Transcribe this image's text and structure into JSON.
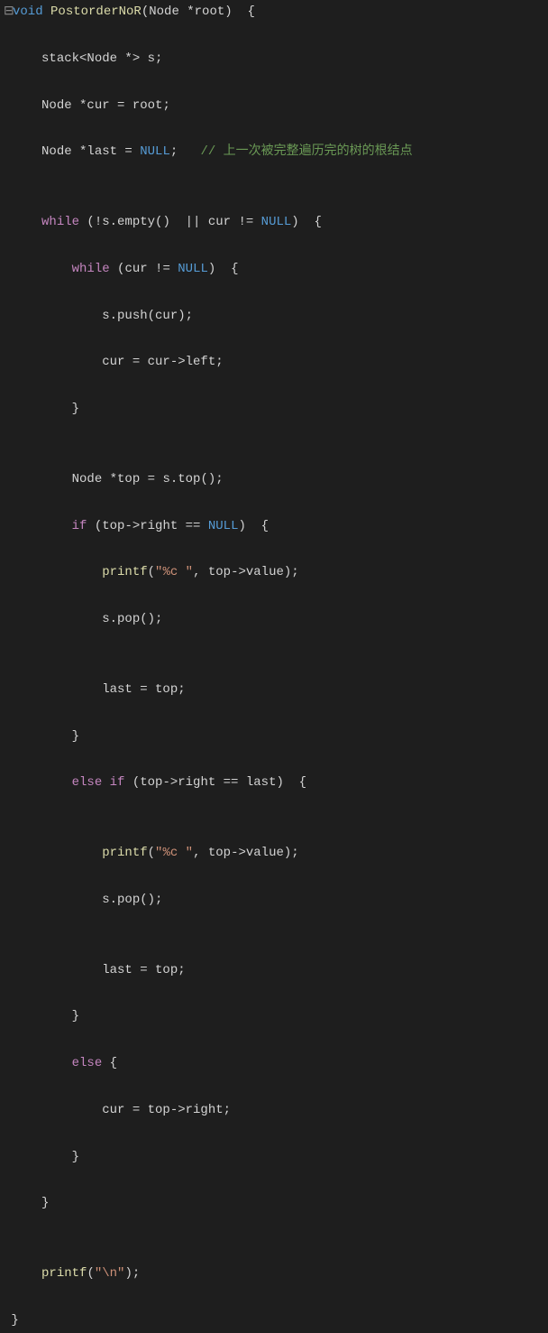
{
  "code": {
    "l01_collapse": "⊟",
    "l01_kw": "void",
    "l01_func": "PostorderNoR",
    "l01_params": "(Node *root)  {",
    "l02": "stack<Node *> s;",
    "l03": "Node *cur = root;",
    "l04_a": "Node *last = ",
    "l04_null": "NULL",
    "l04_b": ";   ",
    "l04_comment": "// 上一次被完整遍历完的树的根结点",
    "l05": "",
    "l06_kw": "while",
    "l06_cond": " (!s.empty()  || cur != ",
    "l06_null": "NULL",
    "l06_end": ")  {",
    "l07_kw": "while",
    "l07_cond": " (cur != ",
    "l07_null": "NULL",
    "l07_end": ")  {",
    "l08": "s.push(cur);",
    "l09": "cur = cur->left;",
    "l10": "}",
    "l11": "",
    "l12": "Node *top = s.top();",
    "l13_kw": "if",
    "l13_cond": " (top->right == ",
    "l13_null": "NULL",
    "l13_end": ")  {",
    "l14_func": "printf",
    "l14_a": "(",
    "l14_str": "\"%c \"",
    "l14_b": ", top->value);",
    "l15": "s.pop();",
    "l16": "",
    "l17": "last = top;",
    "l18": "}",
    "l19_kw": "else if",
    "l19_cond": " (top->right == last)  {",
    "l20": "",
    "l21_func": "printf",
    "l21_a": "(",
    "l21_str": "\"%c \"",
    "l21_b": ", top->value);",
    "l22": "s.pop();",
    "l23": "",
    "l24": "last = top;",
    "l25": "}",
    "l26_kw": "else",
    "l26_end": " {",
    "l27": "cur = top->right;",
    "l28": "}",
    "l29": "}",
    "l30": "",
    "l31_func": "printf",
    "l31_a": "(",
    "l31_str": "\"\\n\"",
    "l31_b": ");",
    "l32": "}"
  }
}
